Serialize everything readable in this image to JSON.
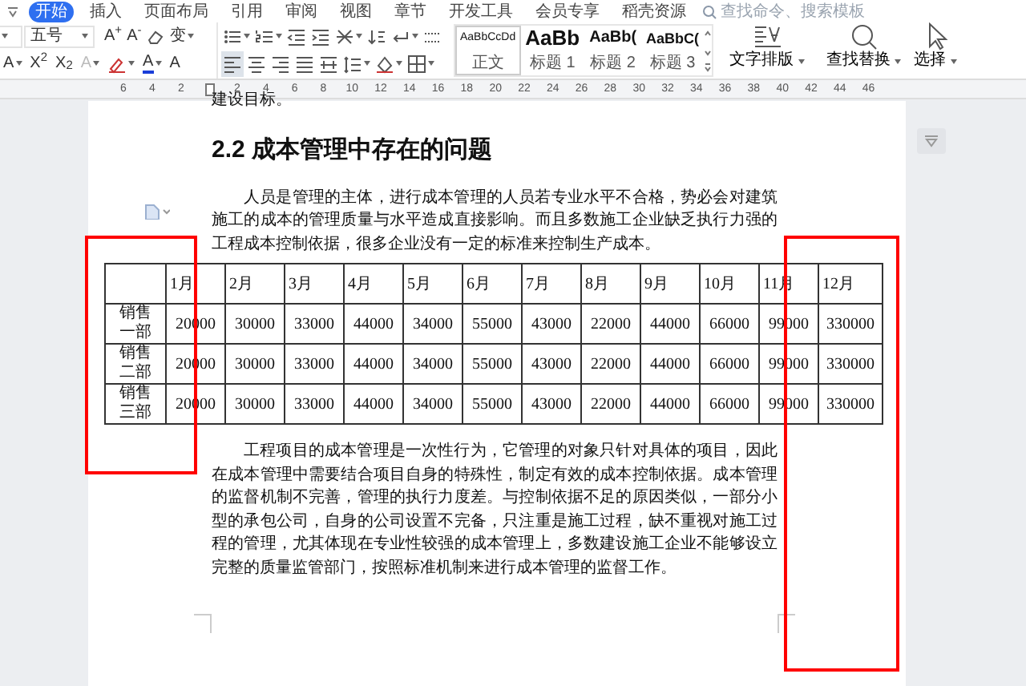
{
  "menu_tabs": [
    {
      "label": "开始",
      "selected": true
    },
    {
      "label": "插入",
      "selected": false
    },
    {
      "label": "页面布局",
      "selected": false
    },
    {
      "label": "引用",
      "selected": false
    },
    {
      "label": "审阅",
      "selected": false
    },
    {
      "label": "视图",
      "selected": false
    },
    {
      "label": "章节",
      "selected": false
    },
    {
      "label": "开发工具",
      "selected": false
    },
    {
      "label": "会员专享",
      "selected": false
    },
    {
      "label": "稻壳资源",
      "selected": false
    }
  ],
  "search": {
    "placeholder": "查找命令、搜索模板"
  },
  "toolbar": {
    "font_size": "五号",
    "row1_glyphs": [
      "A$^{+}$",
      "A$^{-}$",
      "变"
    ],
    "row2_glyphs": [
      "A",
      "X$^{2}$",
      "X$_{2}$",
      "A",
      "A",
      "A"
    ],
    "alignment_buttons": [
      {
        "selected": true
      },
      {
        "selected": false
      },
      {
        "selected": false
      },
      {
        "selected": false
      },
      {
        "selected": false
      }
    ],
    "styles": [
      {
        "sample": "AaBbCcDd",
        "label": "正文",
        "selected": true
      },
      {
        "sample": "AaBb",
        "label": "标题 1",
        "selected": false
      },
      {
        "sample": "AaBb(",
        "label": "标题 2",
        "selected": false
      },
      {
        "sample": "AaBbC(",
        "label": "标题 3",
        "selected": false
      }
    ],
    "big_buttons": [
      {
        "label": "文字排版"
      },
      {
        "label": "查找替换"
      },
      {
        "label": "选择"
      }
    ]
  },
  "ruler": {
    "left_labels": [
      "6",
      "4",
      "2"
    ],
    "right_labels": [
      "2",
      "4",
      "6",
      "8",
      "10",
      "12",
      "14",
      "16",
      "18",
      "20",
      "22",
      "24",
      "26",
      "28",
      "30",
      "32",
      "34",
      "36",
      "38",
      "40",
      "42",
      "44",
      "46"
    ]
  },
  "document": {
    "top_line": "建设目标。",
    "heading": "2.2 成本管理中存在的问题",
    "paragraph_1": "人员是管理的主体，进行成本管理的人员若专业水平不合格，势必会对建筑施工的成本的管理质量与水平造成直接影响。而且多数施工企业缺乏执行力强的工程成本控制依据，很多企业没有一定的标准来控制生产成本。",
    "table": {
      "columns": [
        "1月",
        "2月",
        "3月",
        "4月",
        "5月",
        "6月",
        "7月",
        "8月",
        "9月",
        "10月",
        "11月",
        "12月"
      ],
      "rows": [
        {
          "label": "销售一部",
          "cells": [
            "20000",
            "30000",
            "33000",
            "44000",
            "34000",
            "55000",
            "43000",
            "22000",
            "44000",
            "66000",
            "99000",
            "330000"
          ]
        },
        {
          "label": "销售二部",
          "cells": [
            "20000",
            "30000",
            "33000",
            "44000",
            "34000",
            "55000",
            "43000",
            "22000",
            "44000",
            "66000",
            "99000",
            "330000"
          ]
        },
        {
          "label": "销售三部",
          "cells": [
            "20000",
            "30000",
            "33000",
            "44000",
            "34000",
            "55000",
            "43000",
            "22000",
            "44000",
            "66000",
            "99000",
            "330000"
          ]
        }
      ]
    },
    "paragraph_2": "工程项目的成本管理是一次性行为，它管理的对象只针对具体的项目，因此在成本管理中需要结合项目自身的特殊性，制定有效的成本控制依据。成本管理的监督机制不完善，管理的执行力度差。与控制依据不足的原因类似，一部分小型的承包公司，自身的公司设置不完备，只注重是施工过程，缺不重视对施工过程的管理，尤其体现在专业性较强的成本管理上，多数建设施工企业不能够设立完整的质量监管部门，按照标准机制来进行成本管理的监督工作。"
  }
}
